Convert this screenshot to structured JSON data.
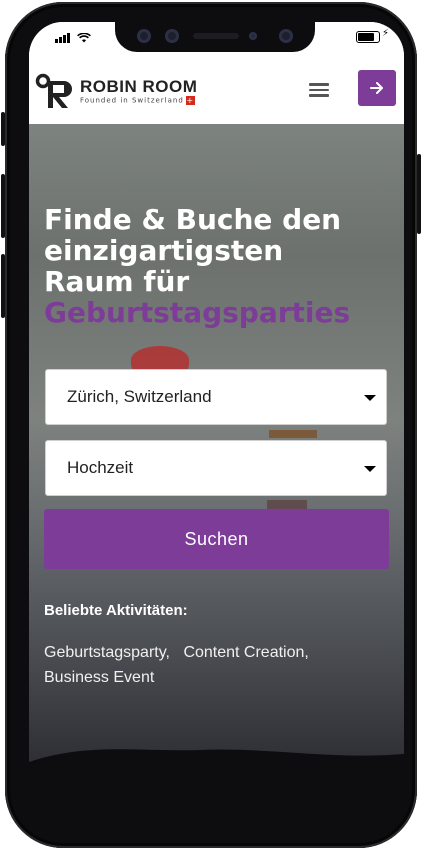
{
  "brand": {
    "name": "ROBIN ROOM",
    "tagline": "Founded in Switzerland",
    "flag_icon": "swiss-flag-icon",
    "accent_color": "#7d3c98"
  },
  "header": {
    "menu_icon": "hamburger-icon",
    "login_icon": "arrow-right-icon"
  },
  "hero": {
    "heading": "Finde & Buche den einzigartigsten Raum für",
    "heading_accent": "Geburtstagsparties"
  },
  "search": {
    "location_value": "Zürich, Switzerland",
    "event_value": "Hochzeit",
    "submit_label": "Suchen"
  },
  "popular": {
    "title": "Beliebte Aktivitäten:",
    "items": [
      "Geburtstagsparty,",
      "Content Creation,",
      "Business Event"
    ]
  }
}
